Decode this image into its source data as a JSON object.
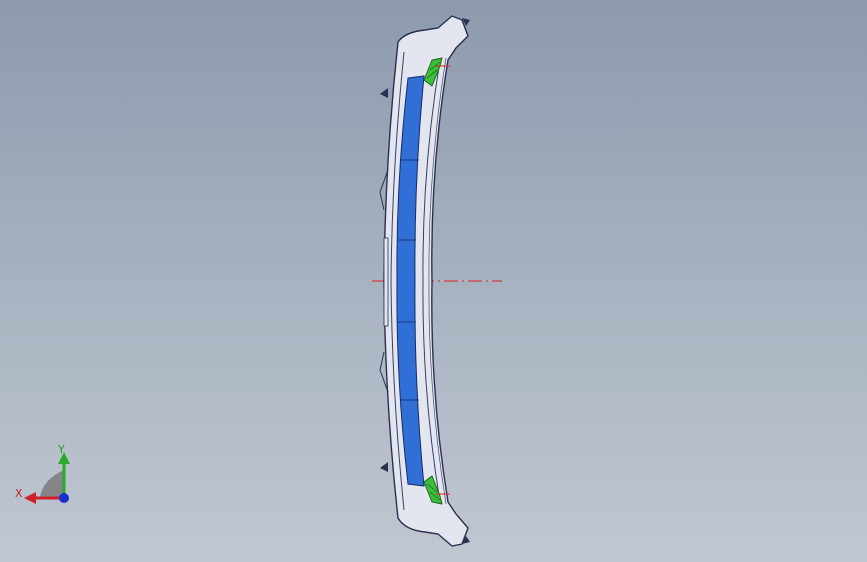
{
  "viewport": {
    "background_top": "#8d9aad",
    "background_bottom": "#c0c7d1"
  },
  "model": {
    "part": "curved-bumper-part",
    "colors": {
      "outline": "#2b2f52",
      "body_fill": "#e4e6ef",
      "blue_face": "#2f6fd6",
      "green_clip": "#3bbf3b",
      "centerline": "#e02020"
    }
  },
  "triad": {
    "x_label": "X",
    "y_label": "Y",
    "colors": {
      "x": "#d0202a",
      "y": "#2aaa2a",
      "z": "#1b2fd0",
      "plane": "#7a7a7a"
    }
  }
}
